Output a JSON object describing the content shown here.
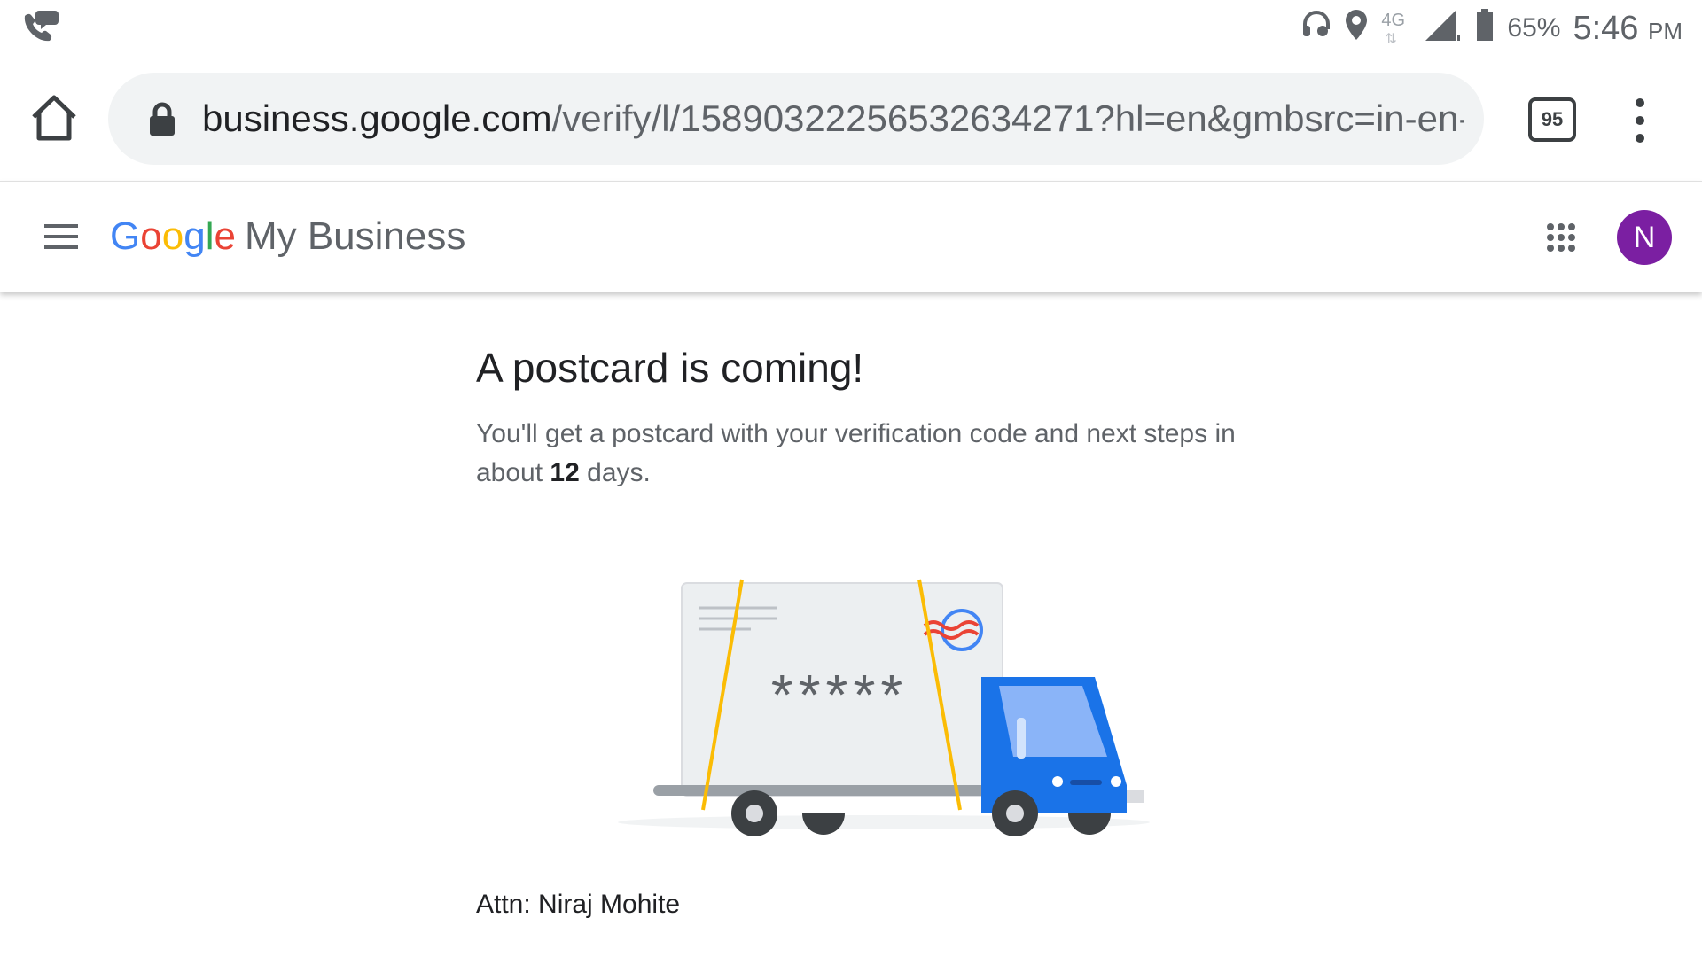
{
  "status_bar": {
    "network": "4G",
    "battery": "65%",
    "time": "5:46",
    "ampm": "PM",
    "icons": [
      "call-icon",
      "headset-icon",
      "location-icon",
      "network-4g-icon",
      "signal-icon",
      "battery-icon"
    ]
  },
  "browser": {
    "url_host": "business.google.com",
    "url_path": "/verify/l/15890322256532634271?hl=en&gmbsrc=in-en-:",
    "tab_count": "95",
    "icons": [
      "home-icon",
      "lock-icon",
      "tabs-icon",
      "more-vert-icon"
    ]
  },
  "header": {
    "logo_letters": [
      "G",
      "o",
      "o",
      "g",
      "l",
      "e"
    ],
    "product": "My Business",
    "avatar_initial": "N",
    "avatar_color": "#7b1fa2",
    "icons": [
      "menu-icon",
      "apps-icon"
    ]
  },
  "main": {
    "title": "A postcard is coming!",
    "desc_before": "You'll get a postcard with your verification code and next steps in about ",
    "days": "12",
    "desc_after": " days.",
    "code_mask": "*****",
    "attn": "Attn: Niraj Mohite"
  },
  "colors": {
    "google_blue": "#4285f4",
    "google_red": "#ea4335",
    "google_yellow": "#fbbc05",
    "google_green": "#34a853",
    "truck_blue": "#1a73e8"
  }
}
